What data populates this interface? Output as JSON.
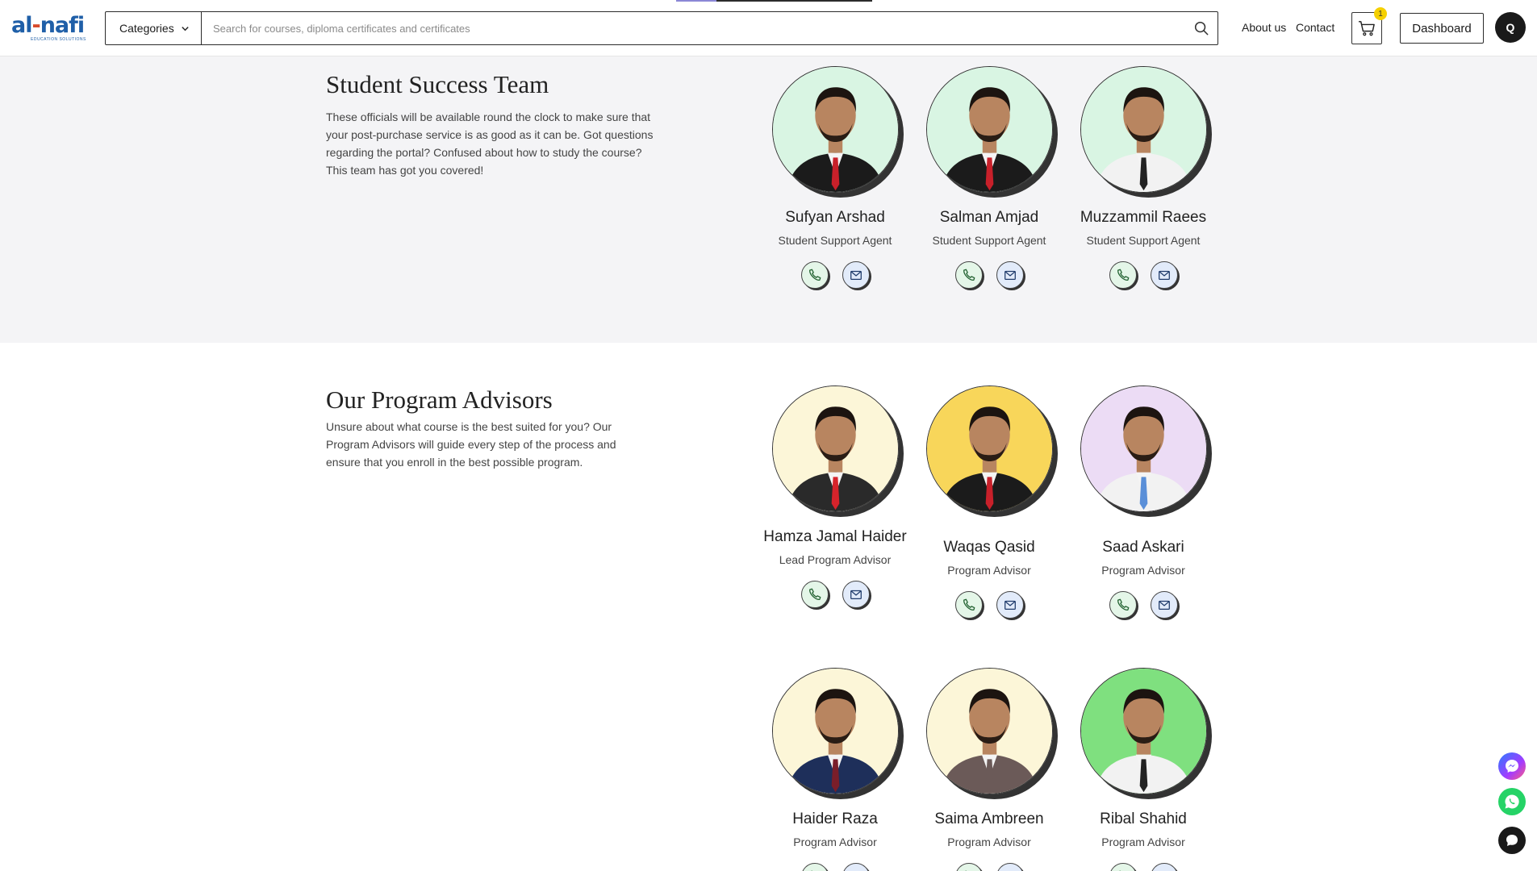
{
  "header": {
    "logo_text_a": "al",
    "logo_text_dash": "-",
    "logo_text_b": "nafi",
    "logo_subtitle": "EDUCATION SOLUTIONS",
    "categories_label": "Categories",
    "search_placeholder": "Search for courses, diploma certificates and certificates",
    "about_label": "About us",
    "contact_label": "Contact",
    "cart_count": "1",
    "dashboard_label": "Dashboard",
    "avatar_initial": "Q"
  },
  "student_success": {
    "title": "Student Success Team",
    "description": "These officials will be available round the clock to make sure that your post-purchase service is as good as it can be. Got questions regarding the portal? Confused about how to study the course? This team has got you covered!",
    "members": [
      {
        "name": "Sufyan Arshad",
        "role": "Student Support Agent",
        "bg": "#d9f5e3",
        "shirt": "#1b1b1b",
        "tie": "#c8202a"
      },
      {
        "name": "Salman Amjad",
        "role": "Student Support Agent",
        "bg": "#d9f5e3",
        "shirt": "#1b1b1b",
        "tie": "#c8202a"
      },
      {
        "name": "Muzzammil Raees",
        "role": "Student Support Agent",
        "bg": "#d9f5e3",
        "shirt": "#f2f2f2",
        "tie": "#222222"
      }
    ]
  },
  "program_advisors": {
    "title": "Our Program Advisors",
    "description": "Unsure about what course is the best suited for you? Our Program Advisors will guide every step of the process and ensure that you enroll in the best possible program.",
    "members": [
      {
        "name": "Hamza Jamal Haider",
        "role": "Lead Program Advisor",
        "bg": "#fcf6d8",
        "shirt": "#2a2a2a",
        "tie": "#d6232b"
      },
      {
        "name": "Waqas Qasid",
        "role": "Program Advisor",
        "bg": "#f8d65a",
        "shirt": "#1b1b1b",
        "tie": "#c8202a"
      },
      {
        "name": "Saad Askari",
        "role": "Program Advisor",
        "bg": "#ecdcf5",
        "shirt": "#f2f2f2",
        "tie": "#5a8fd8"
      },
      {
        "name": "Haider Raza",
        "role": "Program Advisor",
        "bg": "#fcf6d8",
        "shirt": "#1e2f5a",
        "tie": "#7a1e2a"
      },
      {
        "name": "Saima Ambreen",
        "role": "Program Advisor",
        "bg": "#fcf6d8",
        "shirt": "#6b5a58",
        "tie": "#6b5a58"
      },
      {
        "name": "Ribal Shahid",
        "role": "Program Advisor",
        "bg": "#7fe07f",
        "shirt": "#f2f2f2",
        "tie": "#222222"
      }
    ]
  },
  "icons": {
    "phone": "phone-icon",
    "mail": "mail-icon",
    "messenger": "messenger-icon",
    "whatsapp": "whatsapp-icon",
    "chat": "chat-icon"
  }
}
